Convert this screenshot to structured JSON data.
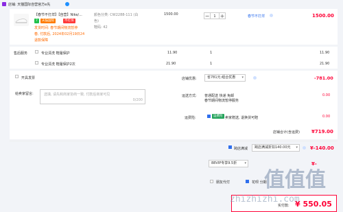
{
  "store": {
    "name": "店铺: 天猫国际自营官方e先",
    "icon": "store-icon"
  },
  "product": {
    "title_line1": "【春节不打烊】【自营】Nike/...",
    "tags": [
      "7",
      "天猫国际"
    ],
    "tag_extra": "不打烊",
    "shipping_note": "发货时间: 春节期间物流暂停",
    "deadline": "春, 付款后, 2024年02月19日24",
    "service_link": "退款保障",
    "attrs": [
      "颜色分类: CW2288-111 (白",
      "色)",
      "鞋码: 42"
    ],
    "unit_price": "1500.00",
    "qty": "1",
    "badge": "春节不打烊",
    "total": "1500.00"
  },
  "services": {
    "label": "售后服务",
    "items": [
      {
        "name": "专业清洗 鞋履保护",
        "price": "11.90",
        "qty": "1",
        "total": "11.90"
      },
      {
        "name": "专业清洗 鞋履保护2次",
        "price": "21.90",
        "qty": "1",
        "total": "21.90"
      }
    ]
  },
  "invoice": {
    "label": "开具发票"
  },
  "remarks": {
    "label": "给卖家留言:",
    "placeholder": "选填, 请先和商家协商一致, 付款后商家可见",
    "counter": "0/200"
  },
  "store_discount": {
    "label": "店铺优惠:",
    "value": "省781元:组合优惠",
    "amount": "-781.00"
  },
  "delivery": {
    "label": "运送方式:",
    "line1": "普通配送 快递 免邮",
    "line2": "春节期间物流暂停服务",
    "amount": "0.00"
  },
  "insurance": {
    "label": "运费险:",
    "badge": "运费险",
    "text": "卖家赠送, 退换货可赔",
    "amount": "0.00"
  },
  "store_total": {
    "label": "店铺合计(含运费)",
    "amount": "¥719.00"
  },
  "cross_store": {
    "label": "跨店满减",
    "select": "跨店满减折扣140.00元",
    "amount": "¥-140.00"
  },
  "vip": {
    "select": "88VIP专享9.5折",
    "amount": "¥-"
  },
  "pay_for_me": {
    "label": "朋友代付",
    "extra": "花呗 分期"
  },
  "final": {
    "label": "实付款:",
    "amount": "¥ 550.05"
  },
  "watermark": {
    "text": "值值值",
    "domain": "zhizhizhi.com"
  },
  "colors": {
    "brand": "#ff0036",
    "accent": "#2f6fed",
    "orange": "#ff5000"
  }
}
